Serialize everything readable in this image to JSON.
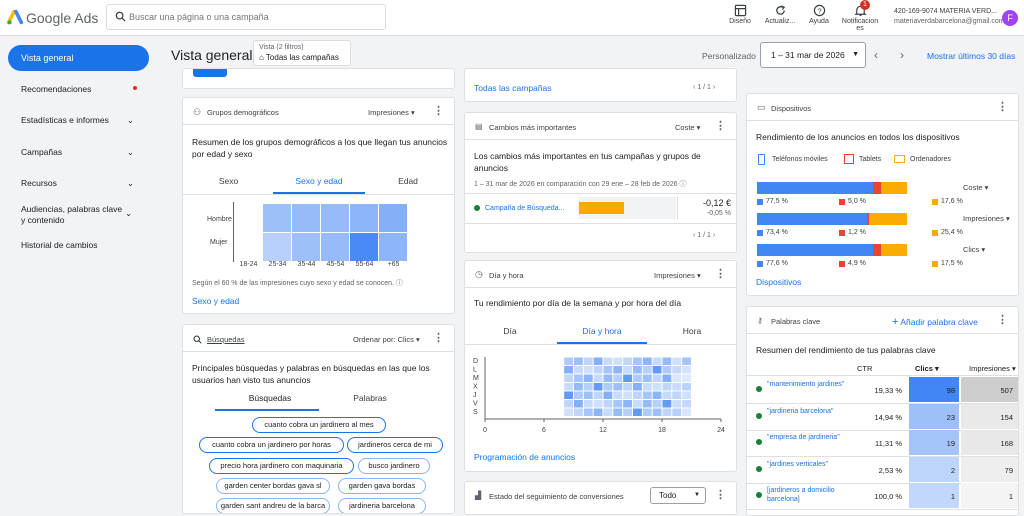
{
  "app": {
    "brand": "Google Ads",
    "search_placeholder": "Buscar una página o una campaña"
  },
  "toolbar": [
    {
      "label": "Diseño",
      "icon": "palette-icon"
    },
    {
      "label": "Actualiz...",
      "icon": "refresh-icon"
    },
    {
      "label": "Ayuda",
      "icon": "help-icon"
    },
    {
      "label": "Notificacion es",
      "icon": "bell-icon"
    }
  ],
  "notification_count": "1",
  "account": {
    "id": "420-169-9074 MATERIA VERD...",
    "email": "materiaverdabarcelona@gmail.com",
    "avatar": "F"
  },
  "sidebar": [
    "Vista general",
    "Recomendaciones",
    "Estadísticas e informes",
    "Campañas",
    "Recursos",
    "Audiencias, palabras clave y contenido",
    "Historial de cambios"
  ],
  "header": {
    "title": "Vista general",
    "filter_label": "Vista (2 filtros)",
    "filter_value": "Todas las campañas",
    "period_label": "Personalizado",
    "date_range": "1 – 31 mar de 2026",
    "show_last": "Mostrar últimos 30 días"
  },
  "demographics": {
    "title": "Grupos demográficos",
    "metric": "Impresiones",
    "summary": "Resumen de los grupos demográficos a los que llegan tus anuncios por edad y sexo",
    "tabs": [
      "Sexo",
      "Sexo y edad",
      "Edad"
    ],
    "rows": [
      "Hombre",
      "Mujer"
    ],
    "ages": [
      "18-24",
      "25-34",
      "35-44",
      "45-54",
      "55-64",
      "+65"
    ],
    "heat": [
      [
        0,
        0.45,
        0.5,
        0.5,
        0.55,
        0.6
      ],
      [
        0,
        0.3,
        0.45,
        0.5,
        0.95,
        0.55
      ]
    ],
    "note": "Según el 60 % de las impresiones cuyo sexo y edad se conocen.",
    "link": "Sexo y edad"
  },
  "searches": {
    "title": "Búsquedas",
    "order_label": "Ordenar por:",
    "order_value": "Clics",
    "summary": "Principales búsquedas y palabras en búsquedas en las que los usuarios han visto tus anuncios",
    "tabs": [
      "Búsquedas",
      "Palabras"
    ],
    "chips": [
      "cuanto cobra un jardinero al mes",
      "cuanto cobra un jardinero por horas",
      "jardineros cerca de mi",
      "precio hora jardinero con maquinaria",
      "busco jardinero",
      "garden center bordas gava sl",
      "garden gava bordas",
      "garden sant andreu de la barca",
      "jardineria barcelona"
    ]
  },
  "top_card": {
    "link": "Todas las campañas",
    "pager": "1 / 1"
  },
  "changes": {
    "title": "Cambios más importantes",
    "metric": "Coste",
    "summary": "Los cambios más importantes en tus campañas y grupos de anuncios",
    "compare": "1 – 31 mar de 2026 en comparación con 29 ene – 28 feb de 2026",
    "campaign": "Campaña de Búsqueda...",
    "value": "-0,12 €",
    "pct": "-0,05 %",
    "pager": "1 / 1"
  },
  "dayhour": {
    "title": "Día y hora",
    "metric": "Impresiones",
    "summary": "Tu rendimiento por día de la semana y por hora del día",
    "tabs": [
      "Día",
      "Día y hora",
      "Hora"
    ],
    "days": [
      "D",
      "L",
      "M",
      "X",
      "J",
      "V",
      "S"
    ],
    "hours": [
      "0",
      "6",
      "12",
      "18",
      "24"
    ],
    "link": "Programación de anuncios"
  },
  "conversions": {
    "title": "Estado del seguimiento de conversiones",
    "filter": "Todo"
  },
  "devices": {
    "title": "Dispositivos",
    "summary": "Rendimiento de los anuncios en todos los dispositivos",
    "legend": [
      {
        "name": "Teléfonos móviles",
        "color": "#4285f4"
      },
      {
        "name": "Tablets",
        "color": "#ea4335"
      },
      {
        "name": "Ordenadores",
        "color": "#f9ab00"
      }
    ],
    "rows": [
      {
        "metric": "Coste",
        "values": [
          77.5,
          5.0,
          17.6
        ],
        "labels": [
          "77,5 %",
          "5,0 %",
          "17,6 %"
        ]
      },
      {
        "metric": "Impresiones",
        "values": [
          73.4,
          1.2,
          25.4
        ],
        "labels": [
          "73,4 %",
          "1,2 %",
          "25,4 %"
        ]
      },
      {
        "metric": "Clics",
        "values": [
          77.6,
          4.9,
          17.5
        ],
        "labels": [
          "77,6 %",
          "4,9 %",
          "17,5 %"
        ]
      }
    ],
    "link": "Dispositivos"
  },
  "keywords": {
    "title": "Palabras clave",
    "add": "Añadir palabra clave",
    "summary": "Resumen del rendimiento de tus palabras clave",
    "cols": [
      "CTR",
      "Clics",
      "Impresiones"
    ],
    "rows": [
      {
        "kw": "\"mantenimiento jardines\"",
        "ctr": "19,33 %",
        "clics": "98",
        "impr": "507",
        "clics_level": 1.0,
        "impr_level": 1.0
      },
      {
        "kw": "\"jardineria barcelona\"",
        "ctr": "14,94 %",
        "clics": "23",
        "impr": "154",
        "clics_level": 0.35,
        "impr_level": 0.3
      },
      {
        "kw": "\"empresa de jardineria\"",
        "ctr": "11,31 %",
        "clics": "19",
        "impr": "168",
        "clics_level": 0.3,
        "impr_level": 0.33
      },
      {
        "kw": "\"jardines verticales\"",
        "ctr": "2,53 %",
        "clics": "2",
        "impr": "79",
        "clics_level": 0.12,
        "impr_level": 0.18
      },
      {
        "kw": "[jardineros a domicilio barcelona]",
        "ctr": "100,0 %",
        "clics": "1",
        "impr": "1",
        "clics_level": 0.1,
        "impr_level": 0.02
      }
    ]
  }
}
